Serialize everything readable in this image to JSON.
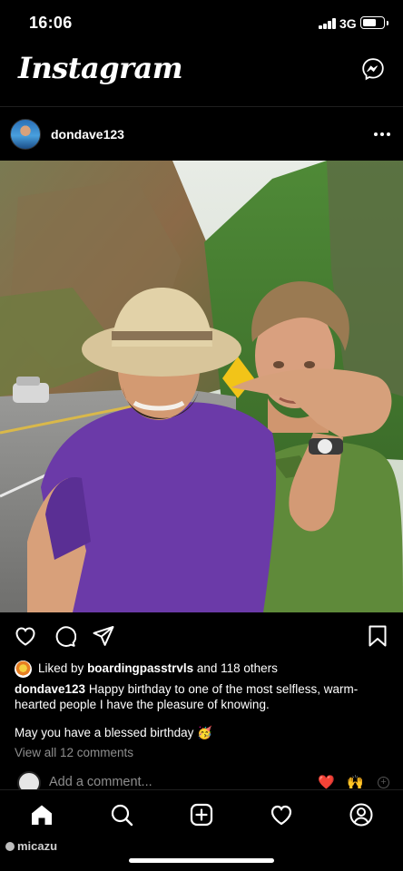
{
  "status_bar": {
    "time": "16:06",
    "network": "3G"
  },
  "header": {
    "logo": "Instagram",
    "messenger_icon": "messenger-icon"
  },
  "post": {
    "username": "dondave123",
    "photo_description_icon": "photo",
    "likes": {
      "prefix": "Liked by",
      "user": "boardingpasstrvls",
      "suffix": "and 118 others"
    },
    "caption": {
      "username": "dondave123",
      "text": "Happy birthday to one of the most selfless, warm-hearted people I have the pleasure of knowing.",
      "line2": "May you have a blessed birthday 🥳"
    },
    "view_comments": "View all 12 comments",
    "add_comment_placeholder": "Add a comment...",
    "quick_emojis": [
      "❤️",
      "🙌"
    ]
  },
  "actions": [
    "heart-icon",
    "comment-icon",
    "share-icon",
    "bookmark-icon"
  ],
  "tabs": [
    "home-icon",
    "search-icon",
    "new-post-icon",
    "activity-icon",
    "profile-icon"
  ],
  "watermark": "micazu",
  "colors": {
    "background": "#000000",
    "secondary_text": "#8e8e8e",
    "text": "#ffffff"
  }
}
